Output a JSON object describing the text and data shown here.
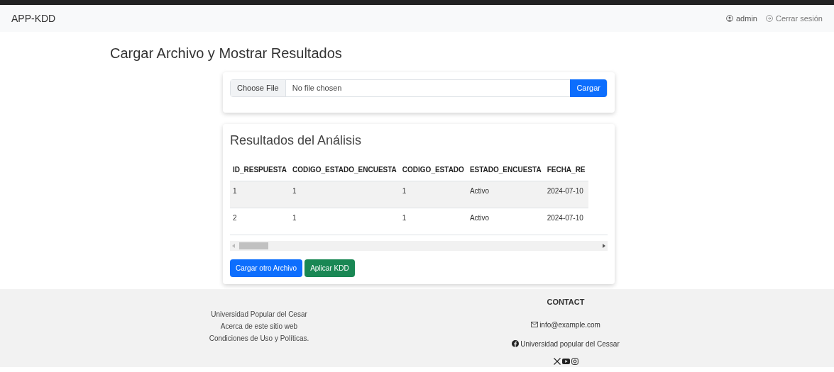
{
  "navbar": {
    "brand": "APP-KDD",
    "user": "admin",
    "logout": "Cerrar sesión"
  },
  "page_title": "Cargar Archivo y Mostrar Resultados",
  "upload": {
    "choose_button": "Choose File",
    "file_status": "No file chosen",
    "submit": "Cargar"
  },
  "results": {
    "title": "Resultados del Análisis",
    "table": {
      "columns": [
        "ID_RESPUESTA",
        "CODIGO_ESTADO_ENCUESTA",
        "CODIGO_ESTADO",
        "ESTADO_ENCUESTA",
        "FECHA_RE"
      ],
      "rows": [
        [
          "1",
          "1",
          "1",
          "Activo",
          "2024-07-10"
        ],
        [
          "2",
          "1",
          "1",
          "Activo",
          "2024-07-10"
        ]
      ]
    },
    "buttons": [
      {
        "label": "Cargar otro Archivo",
        "kind": "primary"
      },
      {
        "label": "Aplicar KDD",
        "kind": "success"
      }
    ]
  },
  "footer": {
    "links": [
      "Universidad Popular del Cesar",
      "Acerca de este sitio web",
      "Condiciones de Uso y Políticas."
    ],
    "contact_title": "CONTACT",
    "email": "info@example.com",
    "facebook": "Universidad popular del Cessar"
  }
}
